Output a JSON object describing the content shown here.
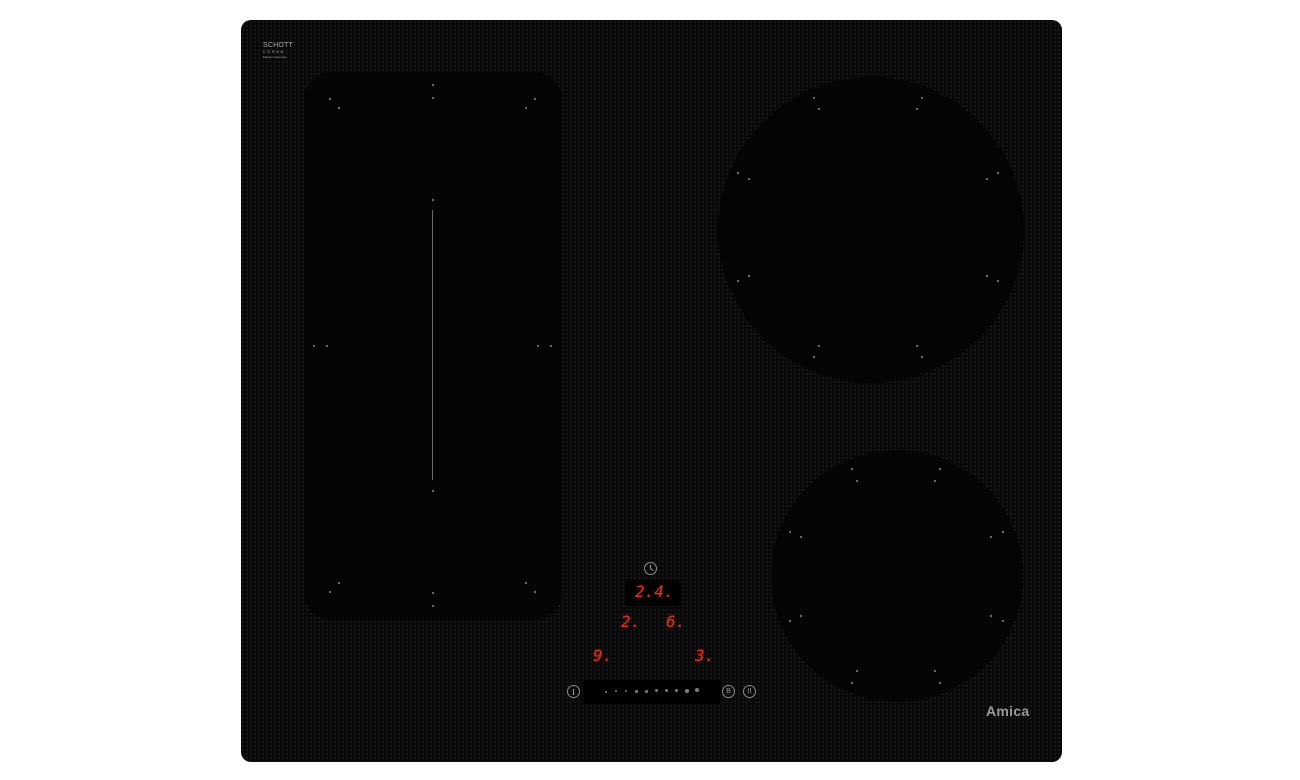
{
  "hob": {
    "branding": {
      "glass_brand_line1": "SCHOTT",
      "glass_brand_line2": "CERAN",
      "glass_brand_line3": "Made in Germany",
      "manufacturer": "Amica"
    },
    "zones": [
      {
        "name": "flex-zone-left",
        "shape": "rounded-rectangle",
        "split": "vertical-divider"
      },
      {
        "name": "zone-rear-right",
        "shape": "circle"
      },
      {
        "name": "zone-front-right",
        "shape": "circle"
      }
    ],
    "displays": {
      "timer": "2.4.",
      "zone_upper_left": "2.",
      "zone_upper_right": "6.",
      "zone_lower_left": "9.",
      "zone_lower_right": "3."
    },
    "controls": {
      "timer_symbol": "clock-icon",
      "power_symbol": "power-icon",
      "booster_label": "B",
      "pause_label": "II",
      "power_levels": 10
    },
    "colors": {
      "glass": "#080808",
      "display_red": "#d2352c",
      "markings": "#8a8a8a"
    }
  }
}
